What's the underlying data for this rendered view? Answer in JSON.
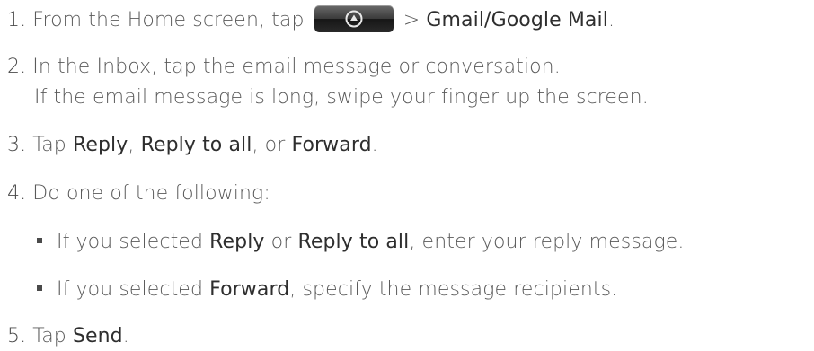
{
  "steps": [
    {
      "num": "1.",
      "pre": "From the Home screen, tap",
      "mid": "> ",
      "app": "Gmail/Google Mail",
      "end": "."
    },
    {
      "num": "2.",
      "text": "In the Inbox, tap the email message or conversation.",
      "sub": "If the email message is long, swipe your finger up the screen."
    },
    {
      "num": "3.",
      "pre": "Tap ",
      "b1": "Reply",
      "s1": ", ",
      "b2": "Reply to all",
      "s2": ", or ",
      "b3": "Forward",
      "end": "."
    },
    {
      "num": "4.",
      "text": "Do one of the following:"
    },
    {
      "num": "5.",
      "pre": "Tap ",
      "b1": "Send",
      "end": "."
    }
  ],
  "bullets": [
    {
      "pre": "If you selected ",
      "b1": "Reply",
      "s1": " or ",
      "b2": "Reply to all",
      "end": ", enter your reply message."
    },
    {
      "pre": "If you selected ",
      "b1": "Forward",
      "end": ", specify the message recipients."
    }
  ],
  "home_button_icon": "home-up-arrow-icon"
}
